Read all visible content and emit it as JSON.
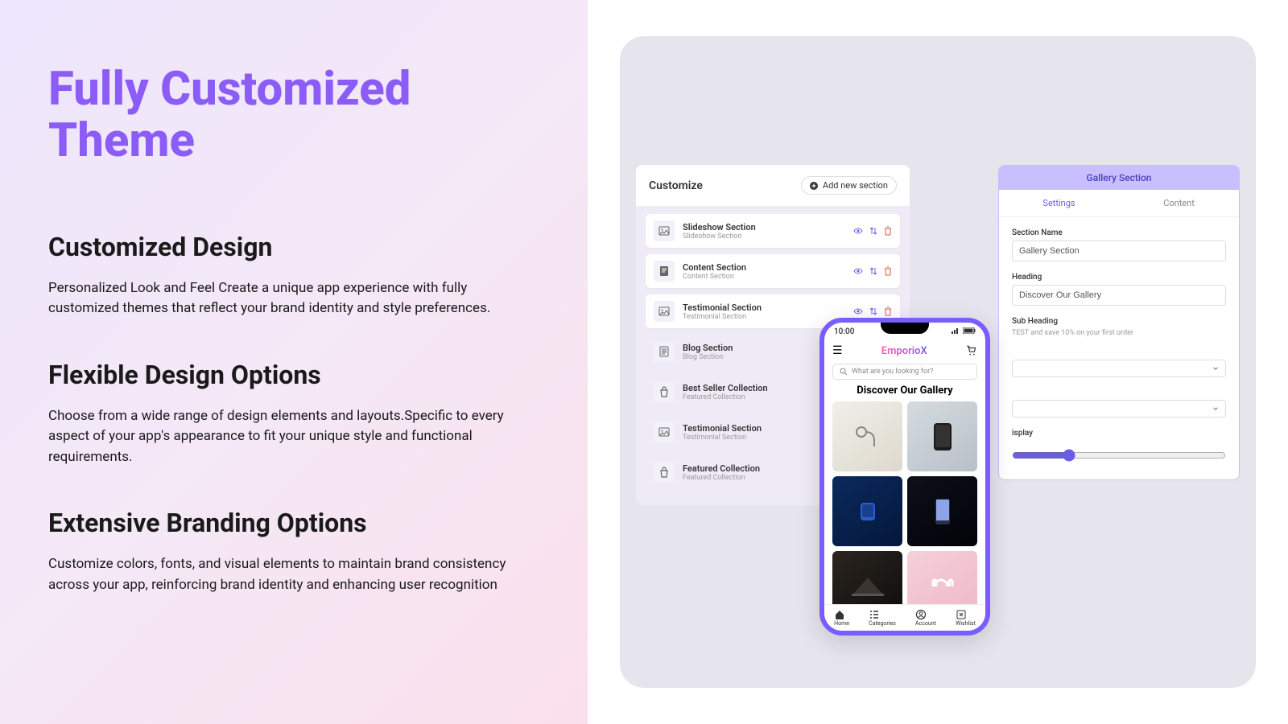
{
  "hero": {
    "title": "Fully Customized Theme",
    "sections": [
      {
        "heading": "Customized Design",
        "body": "Personalized Look and Feel Create a unique app experience with fully customized themes that reflect your brand identity and style preferences."
      },
      {
        "heading": "Flexible Design Options",
        "body": "Choose from a wide range of design elements and layouts.Specific to every aspect of your app's appearance to fit your unique style and functional requirements."
      },
      {
        "heading": "Extensive Branding Options",
        "body": "Customize colors, fonts, and visual elements to maintain brand consistency across your app, reinforcing brand identity and enhancing user recognition"
      }
    ]
  },
  "editor": {
    "title": "Customize",
    "add_btn": "Add new section",
    "rows": [
      {
        "title": "Slideshow Section",
        "sub": "Slideshow Section",
        "icon": "image",
        "actions": true,
        "alt": false
      },
      {
        "title": "Content Section",
        "sub": "Content Section",
        "icon": "doc",
        "actions": true,
        "alt": false
      },
      {
        "title": "Testimonial Section",
        "sub": "Testimonial Section",
        "icon": "image",
        "actions": true,
        "alt": false
      },
      {
        "title": "Blog Section",
        "sub": "Blog Section",
        "icon": "sheet",
        "actions": false,
        "alt": true
      },
      {
        "title": "Best Seller Collection",
        "sub": "Featured Collection",
        "icon": "bag",
        "actions": false,
        "alt": true
      },
      {
        "title": "Testimonial Section",
        "sub": "Testimonial Section",
        "icon": "image",
        "actions": false,
        "alt": true
      },
      {
        "title": "Featured Collection",
        "sub": "Featured Collection",
        "icon": "bag",
        "actions": false,
        "alt": true
      }
    ]
  },
  "settings": {
    "header": "Gallery Section",
    "tabs": {
      "settings": "Settings",
      "content": "Content"
    },
    "section_name_label": "Section Name",
    "section_name_value": "Gallery Section",
    "heading_label": "Heading",
    "heading_value": "Discover Our Gallery",
    "sub_heading_label": "Sub Heading",
    "sub_heading_hint": "TEST and save 10% on your first order",
    "display_label": "isplay"
  },
  "phone": {
    "time": "10:00",
    "brand": "EmporioX",
    "search_placeholder": "What are you looking for?",
    "gallery_title": "Discover Our Gallery",
    "nav": [
      {
        "icon": "home",
        "label": "Home"
      },
      {
        "icon": "grid",
        "label": "Categories"
      },
      {
        "icon": "user",
        "label": "Account"
      },
      {
        "icon": "heart",
        "label": "Wishlist"
      }
    ]
  }
}
